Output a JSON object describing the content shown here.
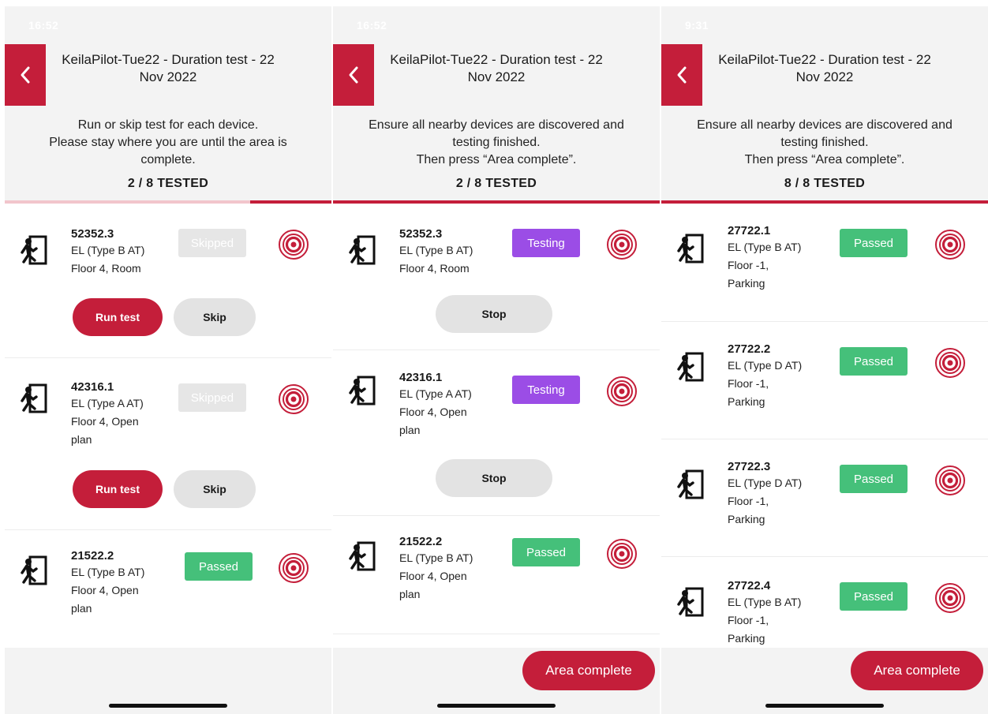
{
  "colors": {
    "brand_red": "#c41e3a",
    "passed_green": "#45c07a",
    "testing_purple": "#9b4de6",
    "skipped_gray": "#e6e6e6"
  },
  "icons": {
    "back": "chevron-left-icon",
    "device": "emergency-exit-icon",
    "locate": "target-icon"
  },
  "screens": [
    {
      "status": {
        "time": "16:52",
        "signal": ""
      },
      "title": "KeilaPilot-Tue22 - Duration test - 22 Nov 2022",
      "instructions": [
        "Run or skip test for each device.",
        "Please stay where you are until the area is",
        "complete."
      ],
      "counter": "2 / 8 TESTED",
      "progress": 0.25,
      "devices": [
        {
          "id": "52352.3",
          "type": "EL (Type B AT)",
          "location": [
            "Floor 4, Room"
          ],
          "status": "Skipped",
          "actions": [
            "Run test",
            "Skip"
          ]
        },
        {
          "id": "42316.1",
          "type": "EL (Type A AT)",
          "location": [
            "Floor 4, Open",
            "plan"
          ],
          "status": "Skipped",
          "actions": [
            "Run test",
            "Skip"
          ]
        },
        {
          "id": "21522.2",
          "type": "EL (Type B AT)",
          "location": [
            "Floor 4, Open",
            "plan"
          ],
          "status": "Passed"
        }
      ]
    },
    {
      "status": {
        "time": "16:52",
        "signal": ""
      },
      "title": "KeilaPilot-Tue22 - Duration test - 22 Nov 2022",
      "instructions": [
        "Ensure all nearby devices are discovered and",
        "testing finished.",
        "Then press “Area complete”."
      ],
      "counter": "2 / 8 TESTED",
      "progress": 1.0,
      "devices": [
        {
          "id": "52352.3",
          "type": "EL (Type B AT)",
          "location": [
            "Floor 4, Room"
          ],
          "status": "Testing",
          "actions": [
            "Stop"
          ]
        },
        {
          "id": "42316.1",
          "type": "EL (Type A AT)",
          "location": [
            "Floor 4, Open",
            "plan"
          ],
          "status": "Testing",
          "actions": [
            "Stop"
          ]
        },
        {
          "id": "21522.2",
          "type": "EL (Type B AT)",
          "location": [
            "Floor 4, Open",
            "plan"
          ],
          "status": "Passed"
        }
      ],
      "footer_button": "Area complete"
    },
    {
      "status": {
        "time": "9:31",
        "signal": ""
      },
      "title": "KeilaPilot-Tue22 - Duration test - 22 Nov 2022",
      "instructions": [
        "Ensure all nearby devices are discovered and",
        "testing finished.",
        "Then press “Area complete”."
      ],
      "counter": "8 / 8 TESTED",
      "progress": 1.0,
      "devices": [
        {
          "id": "27722.1",
          "type": "EL (Type B AT)",
          "location": [
            "Floor -1,",
            "Parking"
          ],
          "status": "Passed"
        },
        {
          "id": "27722.2",
          "type": "EL (Type D AT)",
          "location": [
            "Floor -1,",
            "Parking"
          ],
          "status": "Passed"
        },
        {
          "id": "27722.3",
          "type": "EL (Type D AT)",
          "location": [
            "Floor -1,",
            "Parking"
          ],
          "status": "Passed"
        },
        {
          "id": "27722.4",
          "type": "EL (Type B AT)",
          "location": [
            "Floor -1,",
            "Parking"
          ],
          "status": "Passed"
        }
      ],
      "footer_button": "Area complete"
    }
  ]
}
